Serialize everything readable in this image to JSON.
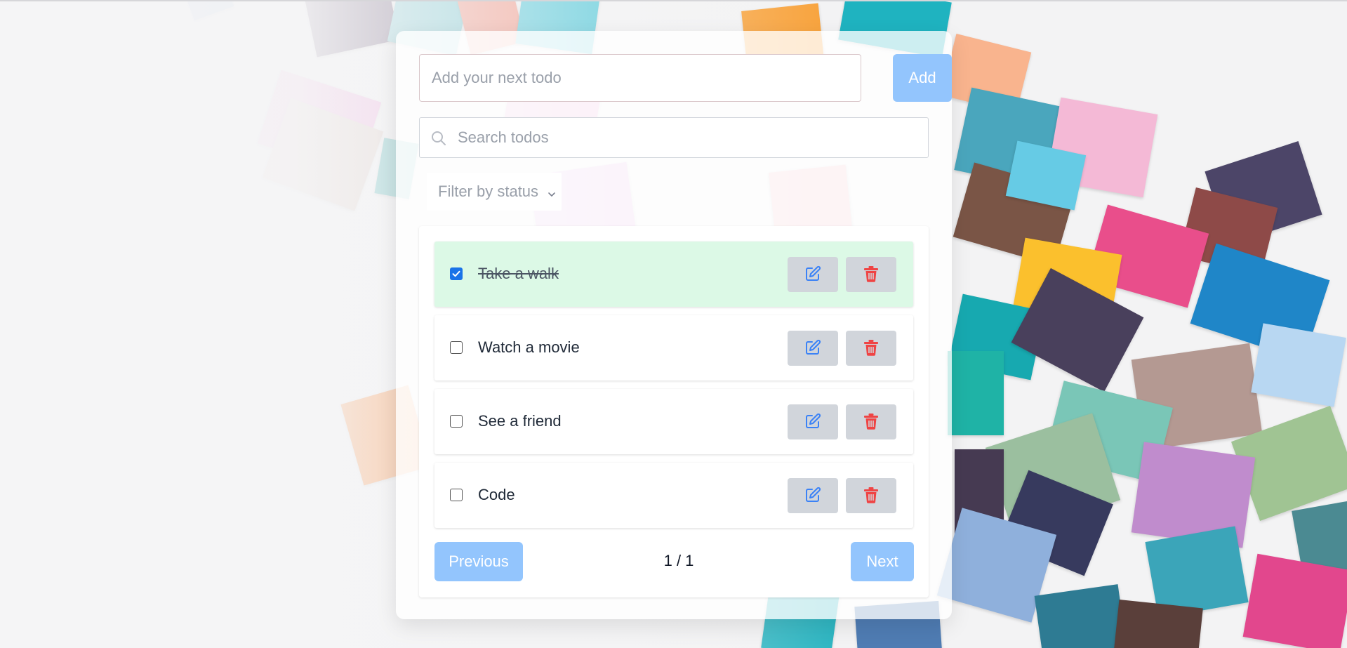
{
  "add_form": {
    "input_placeholder": "Add your next todo",
    "input_value": "",
    "add_label": "Add"
  },
  "search": {
    "placeholder": "Search todos",
    "value": "",
    "icon": "search-icon"
  },
  "filter": {
    "selected": "Filter by status",
    "icon": "chevron-down-icon"
  },
  "todos": [
    {
      "text": "Take a walk",
      "completed": true
    },
    {
      "text": "Watch a movie",
      "completed": false
    },
    {
      "text": "See a friend",
      "completed": false
    },
    {
      "text": "Code",
      "completed": false
    }
  ],
  "item_actions": {
    "edit_icon": "edit-icon",
    "delete_icon": "trash-icon"
  },
  "pagination": {
    "previous_label": "Previous",
    "next_label": "Next",
    "page_indicator": "1 / 1"
  },
  "colors": {
    "accent_button": "#93c5fd",
    "completed_row": "#dcf9e6",
    "edit_icon": "#3b82f6",
    "delete_icon": "#ef4444",
    "action_button_bg": "#d1d5db"
  }
}
